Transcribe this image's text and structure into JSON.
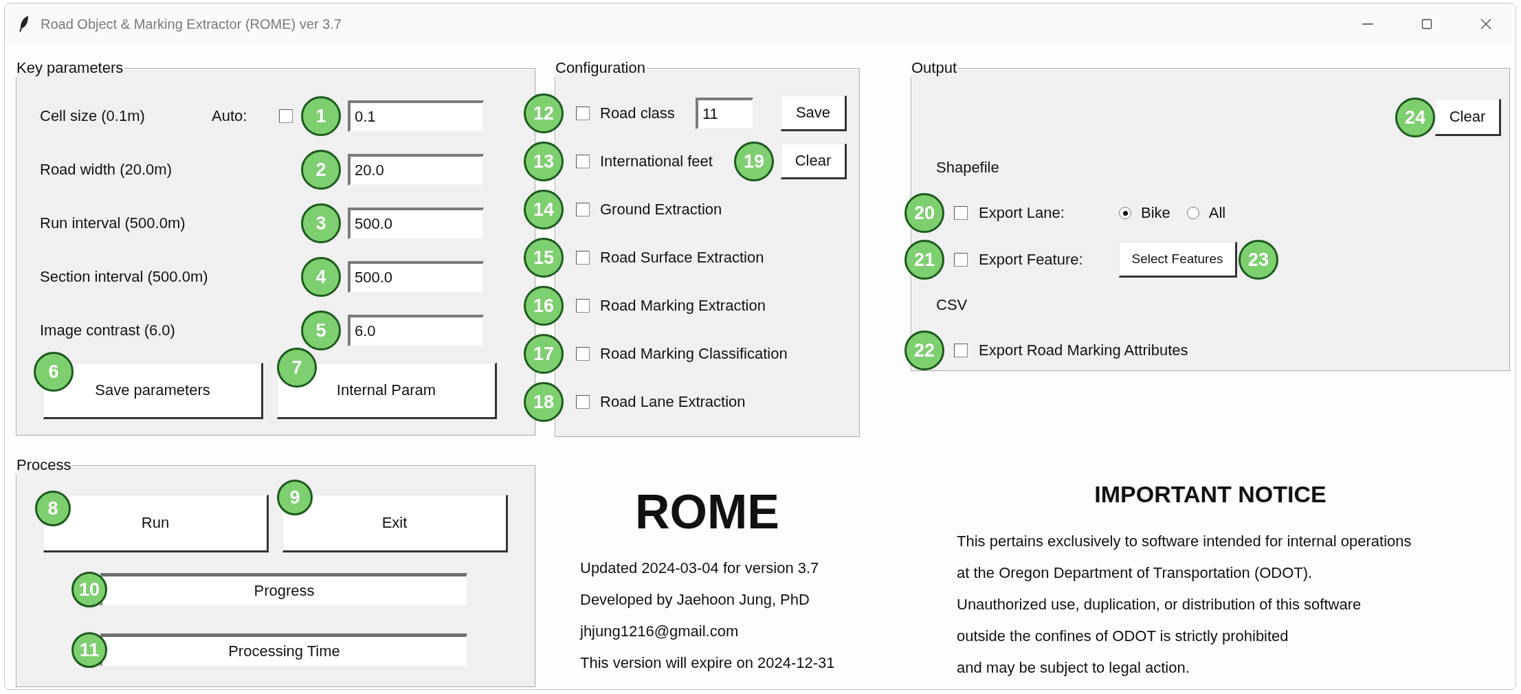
{
  "window": {
    "title": "Road Object & Marking Extractor (ROME) ver 3.7"
  },
  "key_parameters": {
    "title": "Key parameters",
    "rows": [
      {
        "label": "Cell size (0.1m)",
        "badge": "1",
        "value": "0.1",
        "auto": {
          "label": "Auto:",
          "checked": false
        }
      },
      {
        "label": "Road width (20.0m)",
        "badge": "2",
        "value": "20.0"
      },
      {
        "label": "Run interval (500.0m)",
        "badge": "3",
        "value": "500.0"
      },
      {
        "label": "Section interval (500.0m)",
        "badge": "4",
        "value": "500.0"
      },
      {
        "label": "Image contrast (6.0)",
        "badge": "5",
        "value": "6.0"
      }
    ],
    "buttons": [
      {
        "label": "Save parameters",
        "badge": "6"
      },
      {
        "label": "Internal Param",
        "badge": "7"
      }
    ]
  },
  "configuration": {
    "title": "Configuration",
    "options": [
      {
        "badge": "12",
        "label": "Road class",
        "checked": false,
        "kind": "field",
        "value": "11",
        "button": "Save"
      },
      {
        "badge": "13",
        "label": "International feet",
        "checked": false,
        "kind": "button",
        "button_badge": "19",
        "button": "Clear"
      },
      {
        "badge": "14",
        "label": "Ground Extraction",
        "checked": false,
        "kind": "plain"
      },
      {
        "badge": "15",
        "label": "Road Surface Extraction",
        "checked": false,
        "kind": "plain"
      },
      {
        "badge": "16",
        "label": "Road Marking Extraction",
        "checked": false,
        "kind": "plain"
      },
      {
        "badge": "17",
        "label": "Road Marking Classification",
        "checked": false,
        "kind": "plain"
      },
      {
        "badge": "18",
        "label": "Road Lane Extraction",
        "checked": false,
        "kind": "plain"
      }
    ]
  },
  "output": {
    "title": "Output",
    "clear": {
      "badge": "24",
      "label": "Clear"
    },
    "sections": [
      {
        "heading": "Shapefile",
        "options": [
          {
            "badge": "20",
            "label": "Export Lane:",
            "checked": false,
            "kind": "radio",
            "choices": [
              {
                "label": "Bike",
                "selected": true
              },
              {
                "label": "All",
                "selected": false
              }
            ]
          },
          {
            "badge": "21",
            "label": "Export Feature:",
            "checked": false,
            "kind": "button",
            "button": "Select Features",
            "button_badge": "23"
          }
        ]
      },
      {
        "heading": "CSV",
        "options": [
          {
            "badge": "22",
            "label": "Export Road Marking Attributes",
            "checked": false,
            "kind": "plain"
          }
        ]
      }
    ]
  },
  "process": {
    "title": "Process",
    "buttons": [
      {
        "label": "Run",
        "badge": "8"
      },
      {
        "label": "Exit",
        "badge": "9"
      }
    ],
    "bars": [
      {
        "label": "Progress",
        "badge": "10"
      },
      {
        "label": "Processing Time",
        "badge": "11"
      }
    ]
  },
  "about": {
    "title": "ROME",
    "lines": [
      "Updated 2024-03-04 for version 3.7",
      "Developed by Jaehoon Jung, PhD",
      "jhjung1216@gmail.com",
      "This version will expire on 2024-12-31"
    ]
  },
  "notice": {
    "title": "IMPORTANT NOTICE",
    "lines": [
      "This pertains exclusively to software intended for internal operations",
      "at the Oregon Department of Transportation (ODOT).",
      "Unauthorized use, duplication, or distribution of this software",
      "outside the confines of ODOT is strictly prohibited",
      "and may be subject to legal action."
    ]
  }
}
